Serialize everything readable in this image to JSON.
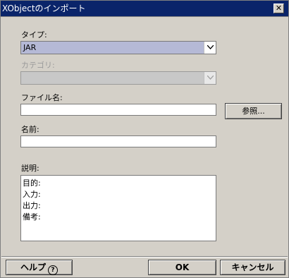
{
  "window": {
    "title": "XObjectのインポート",
    "close_glyph": "✕"
  },
  "type_field": {
    "label": "タイプ:",
    "selected": "JAR"
  },
  "category_field": {
    "label": "カテゴリ:",
    "selected": ""
  },
  "filename_field": {
    "label": "ファイル名:",
    "value": "",
    "browse_label": "参照..."
  },
  "name_field": {
    "label": "名前:",
    "value": ""
  },
  "description_field": {
    "label": "説明:",
    "lines": [
      "目的:",
      "入力:",
      "出力:",
      "備考:"
    ]
  },
  "footer": {
    "help_label": "ヘルプ",
    "help_icon": "?",
    "ok_label": "OK",
    "cancel_label": "キャンセル"
  }
}
